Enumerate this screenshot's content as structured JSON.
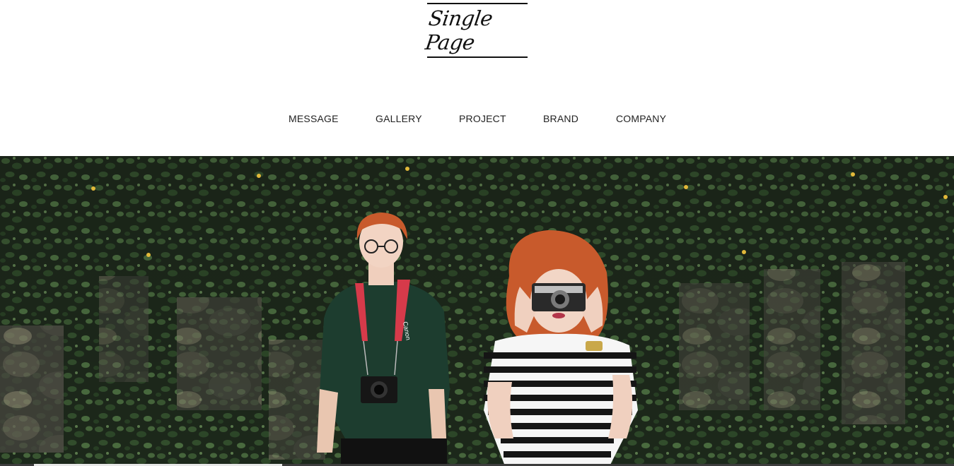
{
  "logo": {
    "text": "Single Page"
  },
  "nav": {
    "items": [
      {
        "label": "MESSAGE"
      },
      {
        "label": "GALLERY"
      },
      {
        "label": "PROJECT"
      },
      {
        "label": "BRAND"
      },
      {
        "label": "COMPANY"
      }
    ]
  },
  "hero": {
    "image": "two-photographers-ivy-wall",
    "camera_strap_text": "Canon"
  },
  "slider": {
    "progress_fraction": 0.26
  },
  "colors": {
    "ivy_dark": "#1e2a1c",
    "ivy_light": "#4a6b3f",
    "strap_red": "#d63a4a",
    "sweater_green": "#1d3d2f",
    "hair_red": "#c85a2c"
  }
}
